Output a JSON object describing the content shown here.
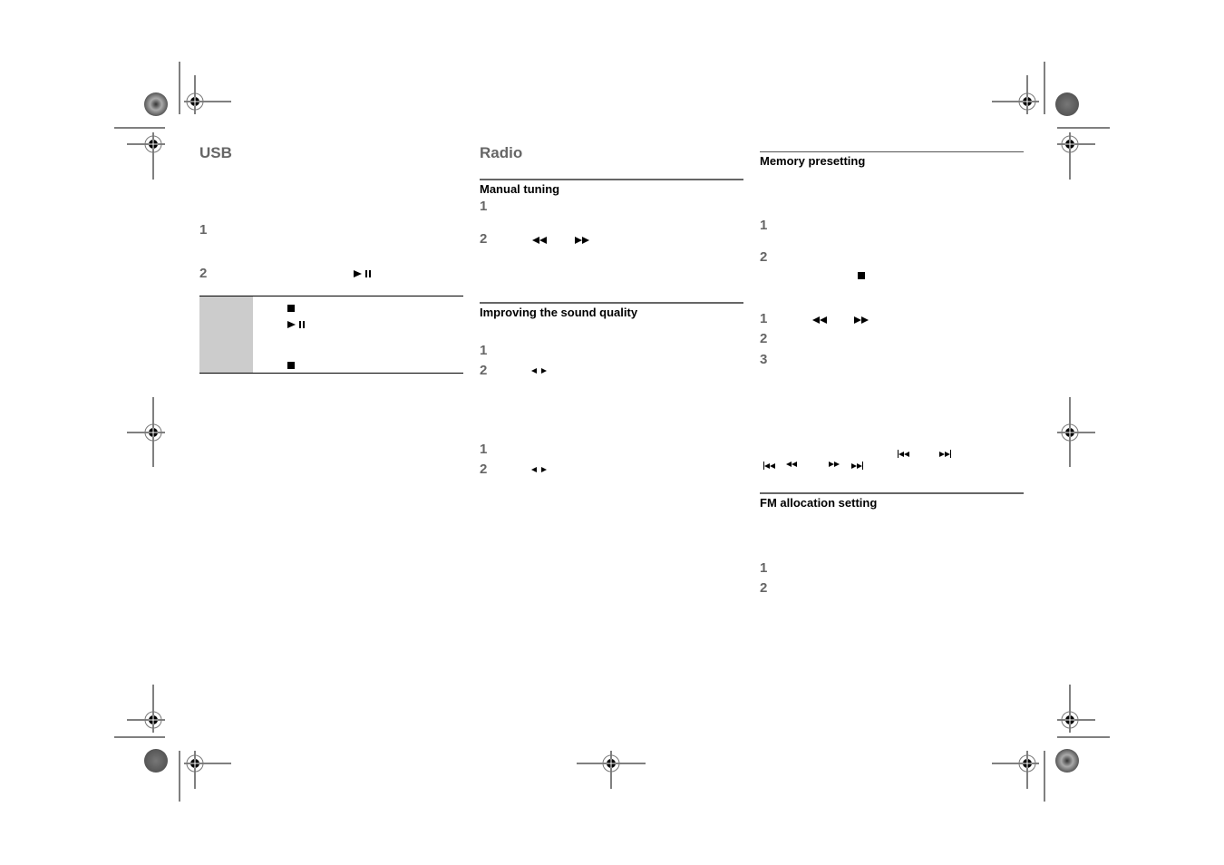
{
  "document": {
    "columns": [
      {
        "heading": "USB",
        "steps": [
          {
            "number": "1",
            "icon": null
          },
          {
            "number": "2",
            "icon": "play-pause-icon"
          }
        ],
        "table": {
          "rows": [
            {
              "icon": "stop-icon"
            },
            {
              "icon": "play-pause-icon"
            },
            {
              "icon": "stop-icon"
            }
          ]
        }
      },
      {
        "heading": "Radio",
        "sections": [
          {
            "title": "Manual tuning",
            "steps": [
              {
                "number": "1",
                "icons": []
              },
              {
                "number": "2",
                "icons": [
                  "rewind-icon",
                  "fast-forward-icon"
                ]
              }
            ]
          },
          {
            "title": "Improving the sound quality",
            "steps": [
              {
                "number": "1",
                "icons": []
              },
              {
                "number": "2",
                "icons": [
                  "left-arrow-icon",
                  "right-arrow-icon"
                ]
              },
              {
                "number": "1",
                "icons": []
              },
              {
                "number": "2",
                "icons": [
                  "left-arrow-icon",
                  "right-arrow-icon"
                ]
              }
            ]
          }
        ]
      },
      {
        "sections": [
          {
            "title": "Memory presetting",
            "steps": [
              {
                "number": "1",
                "icons": []
              },
              {
                "number": "2",
                "icons": [
                  "stop-icon"
                ]
              },
              {
                "number": "1",
                "icons": [
                  "rewind-icon",
                  "fast-forward-icon"
                ]
              },
              {
                "number": "2",
                "icons": []
              },
              {
                "number": "3",
                "icons": []
              }
            ],
            "note_icons": [
              "skip-back-icon",
              "skip-forward-icon",
              "skip-back-icon",
              "rewind-icon",
              "fast-forward-icon",
              "skip-forward-icon"
            ]
          },
          {
            "title": "FM allocation setting",
            "steps": [
              {
                "number": "1",
                "icons": []
              },
              {
                "number": "2",
                "icons": []
              }
            ]
          }
        ]
      }
    ]
  }
}
